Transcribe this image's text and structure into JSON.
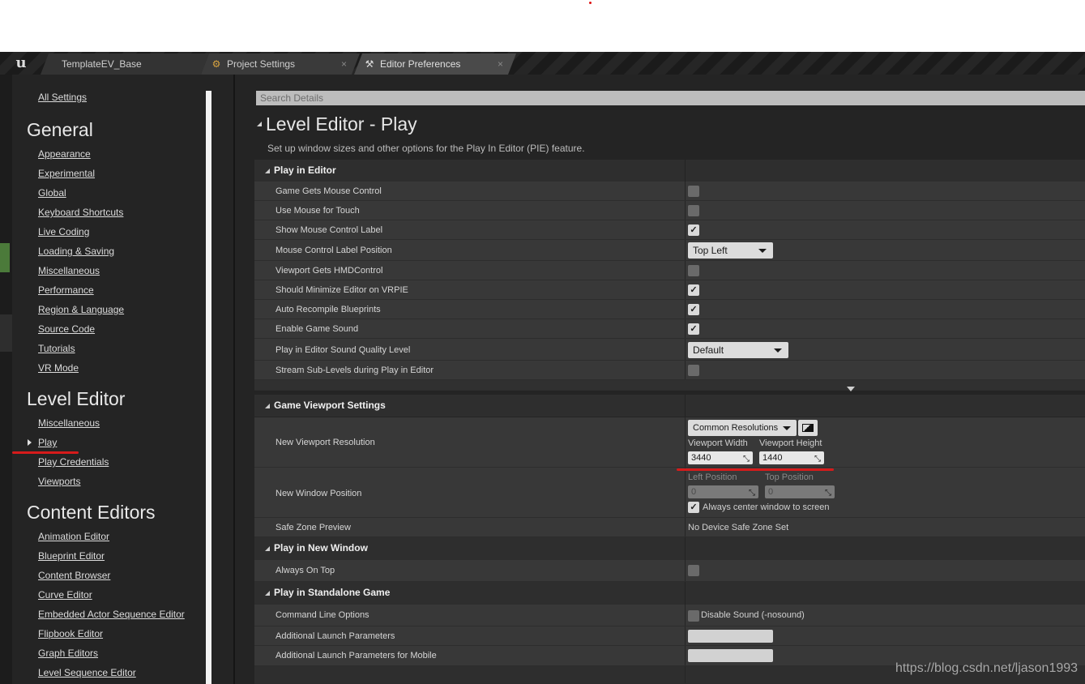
{
  "tabs": [
    {
      "label": "TemplateEV_Base"
    },
    {
      "label": "Project Settings",
      "close": "×"
    },
    {
      "label": "Editor Preferences",
      "close": "×"
    }
  ],
  "logo": "u",
  "nav": {
    "all_settings": "All Settings",
    "general": {
      "title": "General",
      "items": [
        "Appearance",
        "Experimental",
        "Global",
        "Keyboard Shortcuts",
        "Live Coding",
        "Loading & Saving",
        "Miscellaneous",
        "Performance",
        "Region & Language",
        "Source Code",
        "Tutorials",
        "VR Mode"
      ]
    },
    "level_editor": {
      "title": "Level Editor",
      "items": [
        "Miscellaneous",
        "Play",
        "Play Credentials",
        "Viewports"
      ]
    },
    "content_editors": {
      "title": "Content Editors",
      "items": [
        "Animation Editor",
        "Blueprint Editor",
        "Content Browser",
        "Curve Editor",
        "Embedded Actor Sequence Editor",
        "Flipbook Editor",
        "Graph Editors",
        "Level Sequence Editor"
      ]
    }
  },
  "search": {
    "placeholder": "Search Details"
  },
  "section": {
    "title": "Level Editor - Play",
    "description": "Set up window sizes and other options for the Play In Editor (PIE) feature."
  },
  "play_in_editor": {
    "title": "Play in Editor",
    "rows": [
      {
        "label": "Game Gets Mouse Control",
        "checked": false
      },
      {
        "label": "Use Mouse for Touch",
        "checked": false
      },
      {
        "label": "Show Mouse Control Label",
        "checked": true
      },
      {
        "label": "Mouse Control Label Position",
        "value": "Top Left"
      },
      {
        "label": "Viewport Gets HMDControl",
        "checked": false
      },
      {
        "label": "Should Minimize Editor on VRPIE",
        "checked": true
      },
      {
        "label": "Auto Recompile Blueprints",
        "checked": true
      },
      {
        "label": "Enable Game Sound",
        "checked": true
      },
      {
        "label": "Play in Editor Sound Quality Level",
        "value": "Default"
      },
      {
        "label": "Stream Sub-Levels during Play in Editor",
        "checked": false
      }
    ]
  },
  "game_viewport": {
    "title": "Game Viewport Settings",
    "resolution_label": "New Viewport Resolution",
    "common_resolutions": "Common Resolutions",
    "width_label": "Viewport Width",
    "height_label": "Viewport Height",
    "width": "3440",
    "height": "1440",
    "window_position_label": "New Window Position",
    "left_label": "Left Position",
    "top_label": "Top Position",
    "left": "0",
    "top": "0",
    "center_label": "Always center window to screen",
    "center_checked": true,
    "safe_zone_label": "Safe Zone Preview",
    "safe_zone_value": "No Device Safe Zone Set"
  },
  "new_window": {
    "title": "Play in New Window",
    "always_on_top": "Always On Top"
  },
  "standalone": {
    "title": "Play in Standalone Game",
    "command_line": "Command Line Options",
    "disable_sound": "Disable Sound (-nosound)",
    "additional": "Additional Launch Parameters",
    "additional_mobile": "Additional Launch Parameters for Mobile"
  },
  "checkmark": "✓",
  "watermark": "https://blog.csdn.net/ljason1993",
  "colors": {
    "accent_red": "#d61b1b",
    "panel": "#242424",
    "row": "#383838"
  }
}
